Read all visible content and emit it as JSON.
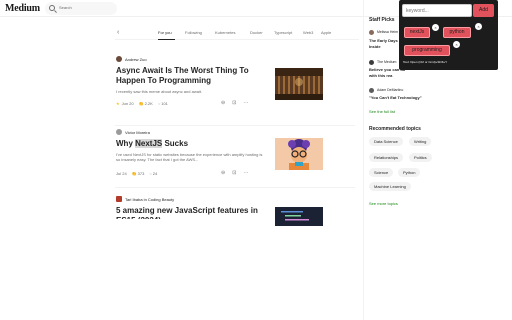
{
  "header": {
    "logo": "Medium",
    "search_placeholder": "Search"
  },
  "tabs": {
    "prev_icon": "‹",
    "items": [
      "For you",
      "Following",
      "Kubernetes",
      "Docker",
      "Typescript",
      "Web3",
      "Apple"
    ],
    "active": "For you"
  },
  "articles": [
    {
      "author": "Andrew Zuo",
      "title": "Async Await Is The Worst Thing To Happen To Programming",
      "subtitle": "I recently saw this meme about async and await.",
      "date": "Jun 20",
      "claps": "2.2K",
      "comments": "101",
      "member_only": true
    },
    {
      "author": "Victor Moreira",
      "title_pre": "Why ",
      "title_highlight": "NextJS",
      "title_post": " Sucks",
      "subtitle": "I've used NextJS for static websites because the experience with amplify hosting is so insanely easy. The fact that I got the AWS...",
      "date": "Jul 24",
      "claps": "373",
      "comments": "24",
      "member_only": false
    },
    {
      "author": "Tari Ibaba in Coding Beauty",
      "title": "5 amazing new JavaScript features in ES15 (2024)"
    }
  ],
  "staff_picks": {
    "heading": "Staff Picks",
    "items": [
      {
        "author": "Melissa Heim",
        "title": "The Early Days Inside"
      },
      {
        "author": "The Medium",
        "title": "Believe you can do with this rea"
      },
      {
        "author": "Adam DeMartino",
        "title": "\"You Can't Eat Technology\""
      }
    ],
    "see_full": "See the full list"
  },
  "recommended": {
    "heading": "Recommended topics",
    "topics": [
      "Data Science",
      "Writing",
      "Relationships",
      "Politics",
      "Science",
      "Python",
      "Machine Learning"
    ],
    "see_more": "See more topics"
  },
  "popup": {
    "input_placeholder": "keyword...",
    "add_label": "Add",
    "tags": [
      "nextJs",
      "python",
      "programming"
    ],
    "remove_glyph": "×",
    "shortcut_hint": "Tool: Open (Ctrl or Cmd)+Shift+Y"
  },
  "colors": {
    "accent_red": "#e2525c",
    "link_green": "#1a8917",
    "member_star": "#ffc017"
  }
}
